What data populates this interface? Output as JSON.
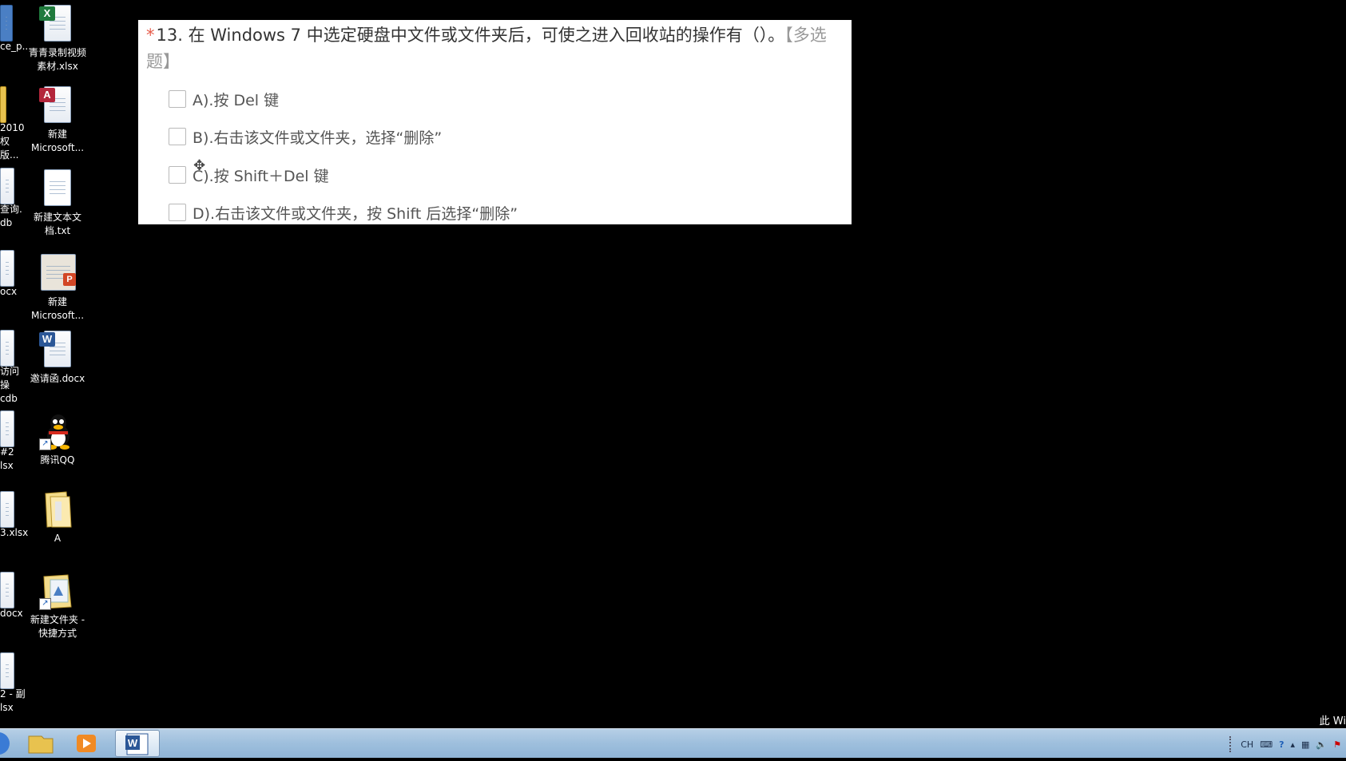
{
  "question": {
    "required_mark": "*",
    "text": "13. 在 Windows 7 中选定硬盘中文件或文件夹后，可使之进入回收站的操作有（）。",
    "tag": "【多选题】",
    "options": [
      {
        "label": "A).按 Del 键"
      },
      {
        "label": "B).右击该文件或文件夹，选择“删除”"
      },
      {
        "label": "C).按 Shift＋Del 键"
      },
      {
        "label": "D).右击该文件或文件夹，按 Shift 后选择“删除”"
      }
    ]
  },
  "desktop": {
    "icons": [
      {
        "label": "青青录制视频\n素材.xlsx",
        "icon": "excel-file-icon"
      },
      {
        "label": "新建\nMicrosoft...",
        "icon": "access-file-icon"
      },
      {
        "label": "新建文本文\n档.txt",
        "icon": "text-file-icon"
      },
      {
        "label": "新建\nMicrosoft...",
        "icon": "powerpoint-file-icon"
      },
      {
        "label": "邀请函.docx",
        "icon": "word-file-icon"
      },
      {
        "label": "腾讯QQ",
        "icon": "qq-icon"
      },
      {
        "label": "A",
        "icon": "folder-icon"
      },
      {
        "label": "新建文件夹 -\n快捷方式",
        "icon": "folder-shortcut-icon"
      }
    ],
    "left_column": [
      {
        "label": "ce_p..."
      },
      {
        "label": "2010\n权版..."
      },
      {
        "label": "查询.\ndb"
      },
      {
        "label": "ocx"
      },
      {
        "label": "访问操\ncdb"
      },
      {
        "label": "#2\nlsx"
      },
      {
        "label": "3.xlsx"
      },
      {
        "label": "docx"
      },
      {
        "label": "2 - 副\nlsx"
      }
    ]
  },
  "taskbar": {
    "tray_language": "CH",
    "watermark": "此 Wi"
  }
}
